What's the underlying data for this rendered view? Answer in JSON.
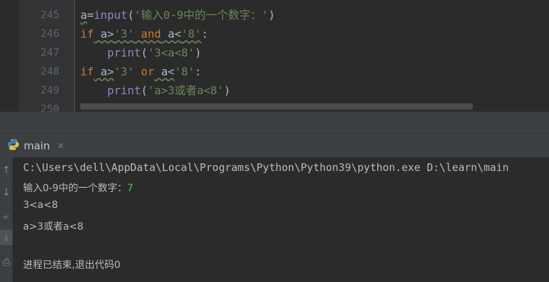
{
  "editor": {
    "lines": [
      {
        "num": "245"
      },
      {
        "num": "246"
      },
      {
        "num": "247"
      },
      {
        "num": "248"
      },
      {
        "num": "249"
      },
      {
        "num": "250"
      }
    ],
    "tokens": {
      "l245_a": "a",
      "l245_eq": "=",
      "l245_fn": "input",
      "l245_p1": "(",
      "l245_str": "'输入0-9中的一个数字：'",
      "l245_p2": ")",
      "l246_if": "if",
      "l246_a": " a>",
      "l246_s3": "'3'",
      "l246_and": " and",
      "l246_a2": " a<",
      "l246_s8": "'8'",
      "l246_colon": ":",
      "l247_fn": "print",
      "l247_p1": "(",
      "l247_str": "'3<a<8'",
      "l247_p2": ")",
      "l248_if": "if",
      "l248_a": " a>",
      "l248_s3": "'3'",
      "l248_or": " or",
      "l248_a2": " a<",
      "l248_s8": "'8'",
      "l248_colon": ":",
      "l249_fn": "print",
      "l249_p1": "(",
      "l249_str": "'a>3或者a<8'",
      "l249_p2": ")"
    }
  },
  "run_tab": {
    "label": "main",
    "close": "×"
  },
  "console": {
    "command": "C:\\Users\\dell\\AppData\\Local\\Programs\\Python\\Python39\\python.exe D:\\learn\\main",
    "prompt": "输入0-9中的一个数字：",
    "user_input": "7",
    "out1": "3<a<8",
    "out2": "a>3或者a<8",
    "exit": "进程已结束,退出代码0"
  },
  "toolbar": {
    "up": "↑",
    "down": "↓",
    "wrap": "⤶",
    "scroll_end": "⤓",
    "print": "⎙"
  },
  "colors": {
    "keyword": "#cc7832",
    "string": "#6a8759",
    "builtin": "#8888c6",
    "user_input": "#4fbf4f"
  }
}
